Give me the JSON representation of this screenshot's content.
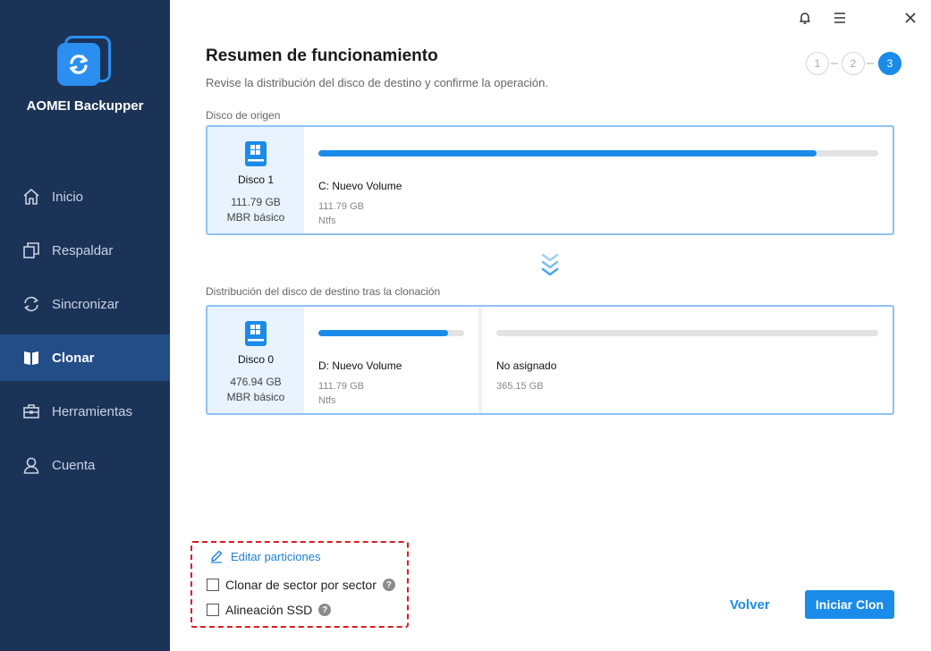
{
  "app": {
    "name": "AOMEI Backupper"
  },
  "sidebar": {
    "items": [
      {
        "label": "Inicio",
        "icon": "home-icon",
        "active": false
      },
      {
        "label": "Respaldar",
        "icon": "backup-icon",
        "active": false
      },
      {
        "label": "Sincronizar",
        "icon": "sync-icon",
        "active": false
      },
      {
        "label": "Clonar",
        "icon": "clone-icon",
        "active": true
      },
      {
        "label": "Herramientas",
        "icon": "tools-icon",
        "active": false
      },
      {
        "label": "Cuenta",
        "icon": "account-icon",
        "active": false
      }
    ]
  },
  "titlebar": {
    "icons": [
      "bell-icon",
      "menu-icon",
      "close-icon"
    ]
  },
  "header": {
    "title": "Resumen de funcionamiento",
    "subtitle": "Revise la distribución del disco de destino y confirme la operación.",
    "steps": [
      "1",
      "2",
      "3"
    ],
    "current_step": 3
  },
  "source": {
    "label": "Disco de origen",
    "disk": {
      "name": "Disco 1",
      "size": "111.79 GB",
      "type": "MBR básico"
    },
    "partitions": [
      {
        "name": "C: Nuevo Volume",
        "size": "111.79 GB",
        "fs": "Ntfs",
        "used_fraction": 0.89
      }
    ]
  },
  "destination": {
    "label": "Distribución del disco de destino tras la clonación",
    "disk": {
      "name": "Disco 0",
      "size": "476.94 GB",
      "type": "MBR básico"
    },
    "partitions": [
      {
        "name": "D: Nuevo Volume",
        "size": "111.79 GB",
        "fs": "Ntfs",
        "used_fraction": 0.89
      },
      {
        "name": "No asignado",
        "size": "365.15 GB",
        "used_fraction": 0
      }
    ]
  },
  "options": {
    "edit_label": "Editar particiones",
    "sector_clone_label": "Clonar de sector por sector",
    "ssd_align_label": "Alineación SSD",
    "help_glyph": "?"
  },
  "buttons": {
    "back": "Volver",
    "start": "Iniciar Clon"
  },
  "colors": {
    "accent": "#1a8be8",
    "sidebar": "#1c3358",
    "sidebar_active": "#234d86",
    "highlight_border": "#d91c24"
  }
}
